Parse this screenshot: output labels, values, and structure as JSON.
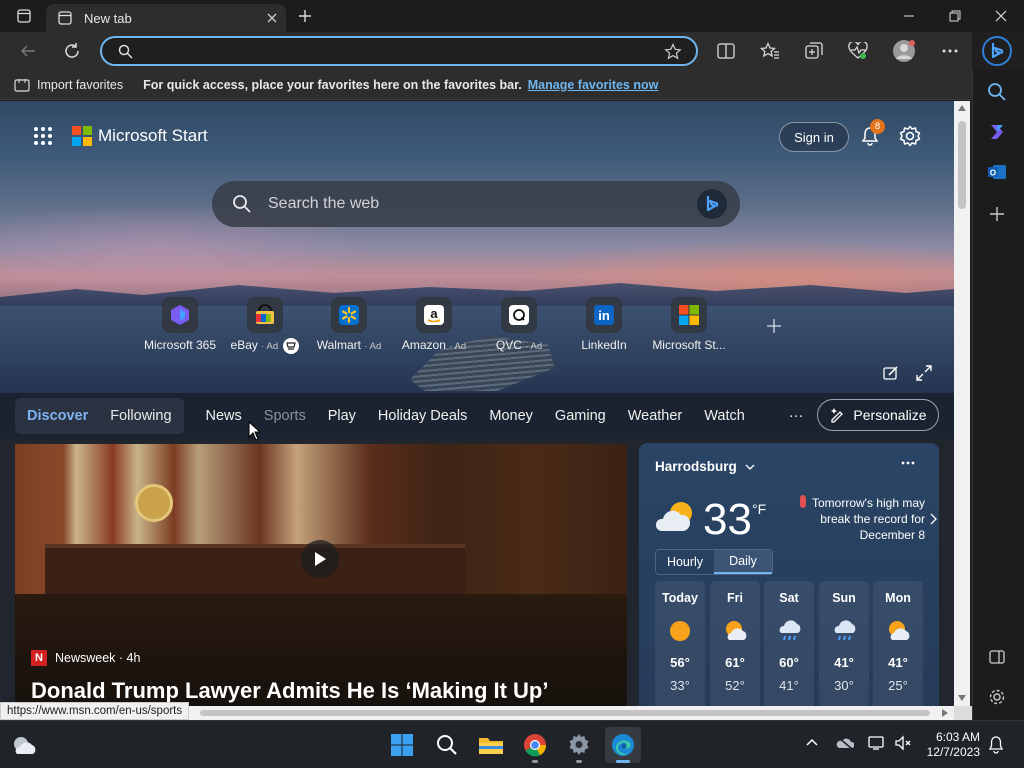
{
  "browser": {
    "tab_title": "New tab",
    "favorites_bar": {
      "import_label": "Import favorites",
      "message": "For quick access, place your favorites here on the favorites bar.",
      "manage_link": "Manage favorites now"
    },
    "status_url": "https://www.msn.com/en-us/sports"
  },
  "page": {
    "brand": "Microsoft Start",
    "sign_in": "Sign in",
    "notification_count": "8",
    "search_placeholder": "Search the web",
    "quick_links": [
      {
        "label": "Microsoft 365",
        "ad": ""
      },
      {
        "label": "eBay",
        "ad": "· Ad"
      },
      {
        "label": "Walmart",
        "ad": "· Ad"
      },
      {
        "label": "Amazon",
        "ad": "· Ad"
      },
      {
        "label": "QVC",
        "ad": "· Ad"
      },
      {
        "label": "LinkedIn",
        "ad": ""
      },
      {
        "label": "Microsoft St...",
        "ad": ""
      }
    ],
    "nav": {
      "discover": "Discover",
      "following": "Following",
      "items": [
        "News",
        "Sports",
        "Play",
        "Holiday Deals",
        "Money",
        "Gaming",
        "Weather",
        "Watch"
      ],
      "more": "···",
      "personalize": "Personalize"
    },
    "news_card": {
      "source": "Newsweek · 4h",
      "source_logo": "N",
      "headline": "Donald Trump Lawyer Admits He Is ‘Making It Up’"
    },
    "weather": {
      "location": "Harrodsburg",
      "temp": "33",
      "unit": "°F",
      "alert": "Tomorrow's high may break the record for December 8",
      "tabs": [
        "Hourly",
        "Daily"
      ],
      "active_tab": "Daily",
      "days": [
        {
          "name": "Today",
          "icon": "sun-icon",
          "hi": "56°",
          "lo": "33°"
        },
        {
          "name": "Fri",
          "icon": "partly-cloudy-icon",
          "hi": "61°",
          "lo": "52°"
        },
        {
          "name": "Sat",
          "icon": "rain-icon",
          "hi": "60°",
          "lo": "41°"
        },
        {
          "name": "Sun",
          "icon": "rain-icon",
          "hi": "41°",
          "lo": "30°"
        },
        {
          "name": "Mon",
          "icon": "partly-cloudy-icon",
          "hi": "41°",
          "lo": "25°"
        }
      ]
    }
  },
  "taskbar": {
    "time": "6:03 AM",
    "date": "12/7/2023"
  },
  "colors": {
    "accent": "#6fb6ef",
    "nav_active": "#7fb3f0",
    "nav_muted": "#8a929c"
  }
}
